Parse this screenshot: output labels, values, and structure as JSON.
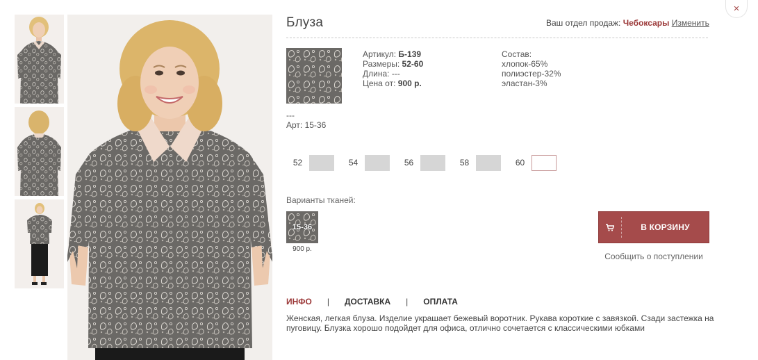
{
  "product": {
    "title": "Блуза",
    "region_prefix": "Ваш отдел продаж:",
    "region_city": "Чебоксары",
    "region_change": "Изменить",
    "article_label": "Артикул:",
    "article_value": "Б-139",
    "sizes_label": "Размеры:",
    "sizes_value": "52-60",
    "length_label": "Длина:",
    "length_value": "---",
    "price_label": "Цена от:",
    "price_value": "900 р.",
    "composition_label": "Состав:",
    "composition": [
      "хлопок-65%",
      "полиэстер-32%",
      "эластан-3%"
    ],
    "extra_line": "---",
    "art_line": "Арт: 15-36"
  },
  "sizes": [
    {
      "label": "52",
      "active": false
    },
    {
      "label": "54",
      "active": false
    },
    {
      "label": "56",
      "active": false
    },
    {
      "label": "58",
      "active": false
    },
    {
      "label": "60",
      "active": true
    }
  ],
  "variants": {
    "label": "Варианты тканей:",
    "items": [
      {
        "code": "15-36",
        "price": "900 р."
      }
    ]
  },
  "actions": {
    "cart_label": "В КОРЗИНУ",
    "notify_label": "Сообщить о поступлении",
    "close_icon": "×"
  },
  "tabs": [
    {
      "label": "ИНФО",
      "active": true
    },
    {
      "label": "ДОСТАВКА",
      "active": false
    },
    {
      "label": "ОПЛАТА",
      "active": false
    }
  ],
  "tab_separator": "|",
  "description": "Женская, легкая блуза. Изделие украшает бежевый воротник. Рукава короткие с завязкой. Сзади застежка на пуговицу. Блузка хорошо подойдет для офиса, отлично сочетается с классическими юбками",
  "colors": {
    "accent": "#a54b4b",
    "accent_text": "#9b3838",
    "size_box": "#d6d6d6"
  }
}
